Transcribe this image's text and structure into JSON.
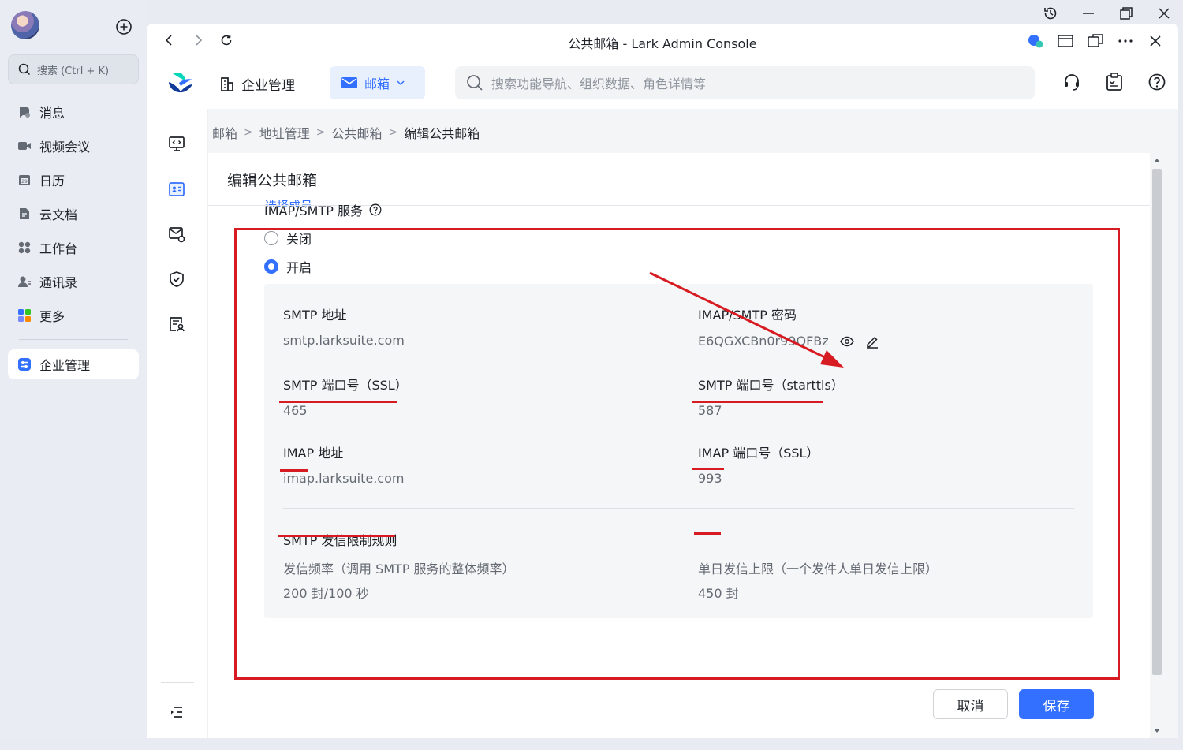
{
  "sidebar": {
    "search_placeholder": "搜索 (Ctrl + K)",
    "items": [
      {
        "label": "消息"
      },
      {
        "label": "视频会议"
      },
      {
        "label": "日历"
      },
      {
        "label": "云文档"
      },
      {
        "label": "工作台"
      },
      {
        "label": "通讯录"
      },
      {
        "label": "更多"
      }
    ],
    "active_item": "企业管理"
  },
  "window": {
    "title": "公共邮箱 - Lark Admin Console"
  },
  "header": {
    "org_label": "企业管理",
    "mail_tab_label": "邮箱",
    "search_placeholder": "搜索功能导航、组织数据、角色详情等"
  },
  "breadcrumb": [
    "邮箱",
    "地址管理",
    "公共邮箱",
    "编辑公共邮箱"
  ],
  "breadcrumb_sep": ">",
  "page": {
    "title": "编辑公共邮箱",
    "cut_link": "选择成员"
  },
  "imap_section": {
    "title": "IMAP/SMTP 服务",
    "option_off": "关闭",
    "option_on": "开启",
    "selected": "开启"
  },
  "fields": {
    "smtp_address_label": "SMTP 地址",
    "smtp_address_value": "smtp.larksuite.com",
    "imap_password_label": "IMAP/SMTP 密码",
    "imap_password_value": "E6QGXCBn0r99OFBz",
    "smtp_ssl_port_label": "SMTP 端口号（SSL）",
    "smtp_ssl_port_value": "465",
    "smtp_starttls_port_label": "SMTP 端口号（starttls）",
    "smtp_starttls_port_value": "587",
    "imap_address_label": "IMAP 地址",
    "imap_address_value": "imap.larksuite.com",
    "imap_ssl_port_label": "IMAP 端口号（SSL）",
    "imap_ssl_port_value": "993"
  },
  "limits": {
    "title": "SMTP 发信限制规则",
    "freq_label": "发信频率（调用 SMTP 服务的整体频率）",
    "freq_value": "200 封/100 秒",
    "daily_label": "单日发信上限（一个发件人单日发信上限）",
    "daily_value": "450 封"
  },
  "buttons": {
    "cancel": "取消",
    "save": "保存"
  },
  "colors": {
    "accent": "#3370ff",
    "annotation": "#d71b22"
  }
}
